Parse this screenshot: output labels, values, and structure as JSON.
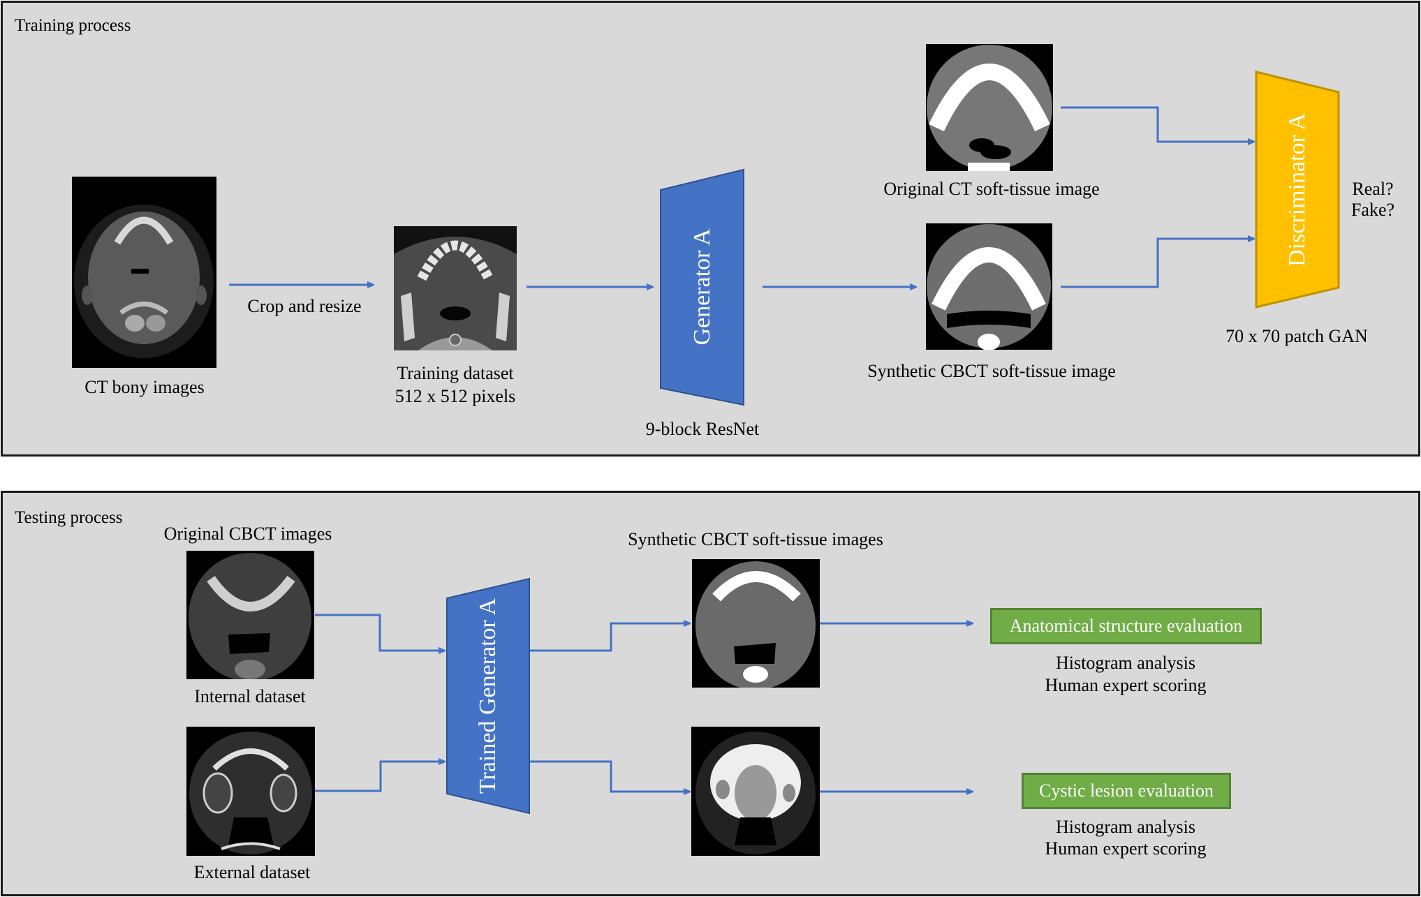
{
  "colors": {
    "panel_bg": "#d9d9d9",
    "arrow": "#4472c4",
    "generator_fill": "#4472c4",
    "generator_stroke": "#2f528f",
    "discriminator_fill": "#ffc000",
    "discriminator_stroke": "#bf9000",
    "eval_fill": "#70ad47",
    "eval_stroke": "#548235"
  },
  "training": {
    "title": "Training process",
    "ct_bony": {
      "label": "CT bony images",
      "icon": "ct-bony-scan-image"
    },
    "crop_label": "Crop and resize",
    "dataset": {
      "line1": "Training dataset",
      "line2": "512 x 512 pixels",
      "icon": "dental-ct-crop-image"
    },
    "generator": {
      "label": "Generator A",
      "caption": "9-block ResNet"
    },
    "original_ct": {
      "label": "Original CT soft-tissue image",
      "icon": "ct-soft-tissue-image"
    },
    "synthetic_cbct": {
      "label": "Synthetic CBCT soft-tissue image",
      "icon": "synthetic-cbct-image"
    },
    "discriminator": {
      "label": "Discriminator A",
      "caption": "70 x 70 patch GAN"
    },
    "output": {
      "line1": "Real?",
      "line2": "Fake?"
    }
  },
  "testing": {
    "title": "Testing process",
    "inputs_heading": "Original CBCT images",
    "internal": {
      "label": "Internal dataset",
      "icon": "cbct-internal-image"
    },
    "external": {
      "label": "External dataset",
      "icon": "cbct-external-image"
    },
    "generator": {
      "label": "Trained Generator A"
    },
    "outputs_heading": "Synthetic CBCT soft-tissue images",
    "evaluations": [
      {
        "label": "Anatomical structure evaluation",
        "methods": [
          "Histogram analysis",
          "Human expert scoring"
        ]
      },
      {
        "label": "Cystic lesion evaluation",
        "methods": [
          "Histogram analysis",
          "Human expert scoring"
        ]
      }
    ]
  }
}
